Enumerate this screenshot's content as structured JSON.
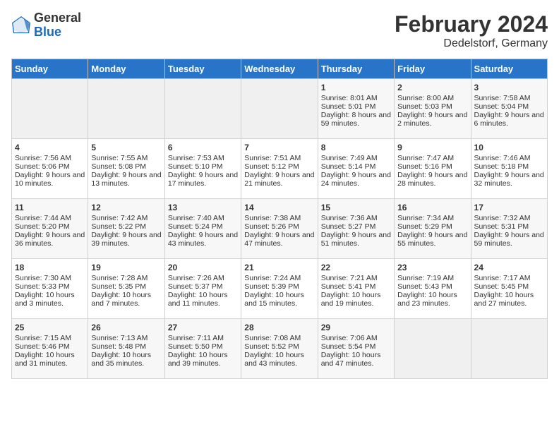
{
  "header": {
    "logo_general": "General",
    "logo_blue": "Blue",
    "title": "February 2024",
    "location": "Dedelstorf, Germany"
  },
  "days_of_week": [
    "Sunday",
    "Monday",
    "Tuesday",
    "Wednesday",
    "Thursday",
    "Friday",
    "Saturday"
  ],
  "weeks": [
    [
      {
        "day": "",
        "sunrise": "",
        "sunset": "",
        "daylight": ""
      },
      {
        "day": "",
        "sunrise": "",
        "sunset": "",
        "daylight": ""
      },
      {
        "day": "",
        "sunrise": "",
        "sunset": "",
        "daylight": ""
      },
      {
        "day": "",
        "sunrise": "",
        "sunset": "",
        "daylight": ""
      },
      {
        "day": "1",
        "sunrise": "Sunrise: 8:01 AM",
        "sunset": "Sunset: 5:01 PM",
        "daylight": "Daylight: 8 hours and 59 minutes."
      },
      {
        "day": "2",
        "sunrise": "Sunrise: 8:00 AM",
        "sunset": "Sunset: 5:03 PM",
        "daylight": "Daylight: 9 hours and 2 minutes."
      },
      {
        "day": "3",
        "sunrise": "Sunrise: 7:58 AM",
        "sunset": "Sunset: 5:04 PM",
        "daylight": "Daylight: 9 hours and 6 minutes."
      }
    ],
    [
      {
        "day": "4",
        "sunrise": "Sunrise: 7:56 AM",
        "sunset": "Sunset: 5:06 PM",
        "daylight": "Daylight: 9 hours and 10 minutes."
      },
      {
        "day": "5",
        "sunrise": "Sunrise: 7:55 AM",
        "sunset": "Sunset: 5:08 PM",
        "daylight": "Daylight: 9 hours and 13 minutes."
      },
      {
        "day": "6",
        "sunrise": "Sunrise: 7:53 AM",
        "sunset": "Sunset: 5:10 PM",
        "daylight": "Daylight: 9 hours and 17 minutes."
      },
      {
        "day": "7",
        "sunrise": "Sunrise: 7:51 AM",
        "sunset": "Sunset: 5:12 PM",
        "daylight": "Daylight: 9 hours and 21 minutes."
      },
      {
        "day": "8",
        "sunrise": "Sunrise: 7:49 AM",
        "sunset": "Sunset: 5:14 PM",
        "daylight": "Daylight: 9 hours and 24 minutes."
      },
      {
        "day": "9",
        "sunrise": "Sunrise: 7:47 AM",
        "sunset": "Sunset: 5:16 PM",
        "daylight": "Daylight: 9 hours and 28 minutes."
      },
      {
        "day": "10",
        "sunrise": "Sunrise: 7:46 AM",
        "sunset": "Sunset: 5:18 PM",
        "daylight": "Daylight: 9 hours and 32 minutes."
      }
    ],
    [
      {
        "day": "11",
        "sunrise": "Sunrise: 7:44 AM",
        "sunset": "Sunset: 5:20 PM",
        "daylight": "Daylight: 9 hours and 36 minutes."
      },
      {
        "day": "12",
        "sunrise": "Sunrise: 7:42 AM",
        "sunset": "Sunset: 5:22 PM",
        "daylight": "Daylight: 9 hours and 39 minutes."
      },
      {
        "day": "13",
        "sunrise": "Sunrise: 7:40 AM",
        "sunset": "Sunset: 5:24 PM",
        "daylight": "Daylight: 9 hours and 43 minutes."
      },
      {
        "day": "14",
        "sunrise": "Sunrise: 7:38 AM",
        "sunset": "Sunset: 5:26 PM",
        "daylight": "Daylight: 9 hours and 47 minutes."
      },
      {
        "day": "15",
        "sunrise": "Sunrise: 7:36 AM",
        "sunset": "Sunset: 5:27 PM",
        "daylight": "Daylight: 9 hours and 51 minutes."
      },
      {
        "day": "16",
        "sunrise": "Sunrise: 7:34 AM",
        "sunset": "Sunset: 5:29 PM",
        "daylight": "Daylight: 9 hours and 55 minutes."
      },
      {
        "day": "17",
        "sunrise": "Sunrise: 7:32 AM",
        "sunset": "Sunset: 5:31 PM",
        "daylight": "Daylight: 9 hours and 59 minutes."
      }
    ],
    [
      {
        "day": "18",
        "sunrise": "Sunrise: 7:30 AM",
        "sunset": "Sunset: 5:33 PM",
        "daylight": "Daylight: 10 hours and 3 minutes."
      },
      {
        "day": "19",
        "sunrise": "Sunrise: 7:28 AM",
        "sunset": "Sunset: 5:35 PM",
        "daylight": "Daylight: 10 hours and 7 minutes."
      },
      {
        "day": "20",
        "sunrise": "Sunrise: 7:26 AM",
        "sunset": "Sunset: 5:37 PM",
        "daylight": "Daylight: 10 hours and 11 minutes."
      },
      {
        "day": "21",
        "sunrise": "Sunrise: 7:24 AM",
        "sunset": "Sunset: 5:39 PM",
        "daylight": "Daylight: 10 hours and 15 minutes."
      },
      {
        "day": "22",
        "sunrise": "Sunrise: 7:21 AM",
        "sunset": "Sunset: 5:41 PM",
        "daylight": "Daylight: 10 hours and 19 minutes."
      },
      {
        "day": "23",
        "sunrise": "Sunrise: 7:19 AM",
        "sunset": "Sunset: 5:43 PM",
        "daylight": "Daylight: 10 hours and 23 minutes."
      },
      {
        "day": "24",
        "sunrise": "Sunrise: 7:17 AM",
        "sunset": "Sunset: 5:45 PM",
        "daylight": "Daylight: 10 hours and 27 minutes."
      }
    ],
    [
      {
        "day": "25",
        "sunrise": "Sunrise: 7:15 AM",
        "sunset": "Sunset: 5:46 PM",
        "daylight": "Daylight: 10 hours and 31 minutes."
      },
      {
        "day": "26",
        "sunrise": "Sunrise: 7:13 AM",
        "sunset": "Sunset: 5:48 PM",
        "daylight": "Daylight: 10 hours and 35 minutes."
      },
      {
        "day": "27",
        "sunrise": "Sunrise: 7:11 AM",
        "sunset": "Sunset: 5:50 PM",
        "daylight": "Daylight: 10 hours and 39 minutes."
      },
      {
        "day": "28",
        "sunrise": "Sunrise: 7:08 AM",
        "sunset": "Sunset: 5:52 PM",
        "daylight": "Daylight: 10 hours and 43 minutes."
      },
      {
        "day": "29",
        "sunrise": "Sunrise: 7:06 AM",
        "sunset": "Sunset: 5:54 PM",
        "daylight": "Daylight: 10 hours and 47 minutes."
      },
      {
        "day": "",
        "sunrise": "",
        "sunset": "",
        "daylight": ""
      },
      {
        "day": "",
        "sunrise": "",
        "sunset": "",
        "daylight": ""
      }
    ]
  ]
}
